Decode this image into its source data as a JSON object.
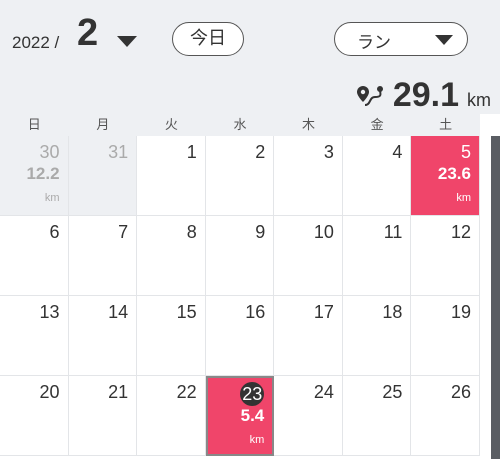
{
  "header": {
    "year": "2022 /",
    "month": "2",
    "today_label": "今日",
    "activity_type": "ラン",
    "total_value": "29.1",
    "total_unit": "km"
  },
  "weekdays": [
    "日",
    "月",
    "火",
    "水",
    "木",
    "金",
    "土"
  ],
  "icons": {
    "month_dropdown": "chevron-down-icon",
    "type_dropdown": "chevron-down-icon",
    "total": "route-icon"
  },
  "colors": {
    "run_day": "#f0456a",
    "header_bg": "#eef0f3"
  },
  "weeks": [
    [
      {
        "day": "30",
        "other": true,
        "distance": "12.2",
        "unit": "km"
      },
      {
        "day": "31",
        "other": true
      },
      {
        "day": "1"
      },
      {
        "day": "2"
      },
      {
        "day": "3"
      },
      {
        "day": "4"
      },
      {
        "day": "5",
        "run": true,
        "distance": "23.6",
        "unit": "km"
      }
    ],
    [
      {
        "day": "6"
      },
      {
        "day": "7"
      },
      {
        "day": "8"
      },
      {
        "day": "9"
      },
      {
        "day": "10"
      },
      {
        "day": "11"
      },
      {
        "day": "12"
      }
    ],
    [
      {
        "day": "13"
      },
      {
        "day": "14"
      },
      {
        "day": "15"
      },
      {
        "day": "16"
      },
      {
        "day": "17"
      },
      {
        "day": "18"
      },
      {
        "day": "19"
      }
    ],
    [
      {
        "day": "20"
      },
      {
        "day": "21"
      },
      {
        "day": "22"
      },
      {
        "day": "23",
        "run": true,
        "today": true,
        "distance": "5.4",
        "unit": "km"
      },
      {
        "day": "24"
      },
      {
        "day": "25"
      },
      {
        "day": "26"
      }
    ]
  ]
}
